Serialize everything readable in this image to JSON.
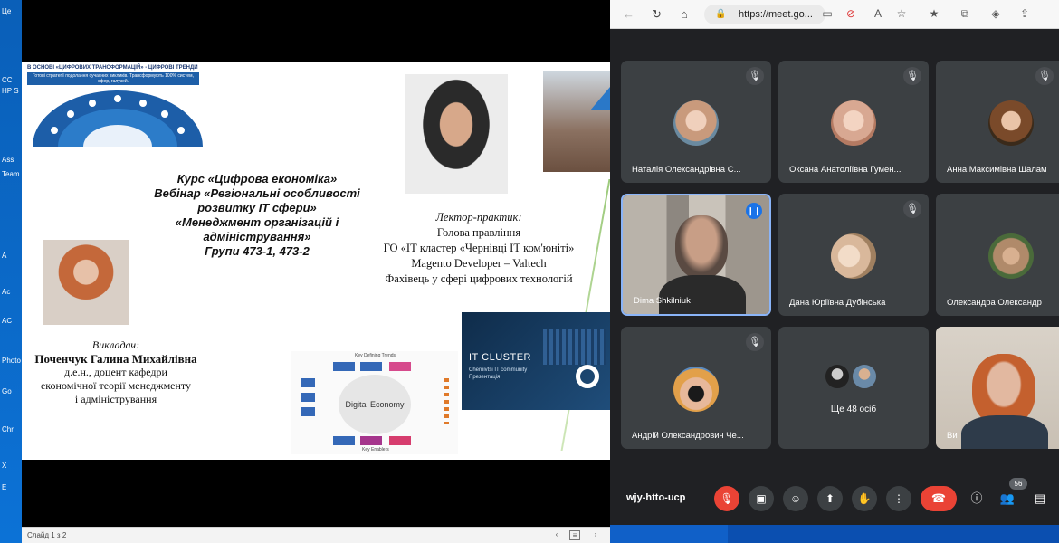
{
  "desktop": {
    "icons": [
      {
        "label": "Це",
        "color": "#2b7bd6"
      },
      {
        "label": "CC",
        "color": "#d9342b"
      },
      {
        "label": "HP S",
        "color": "#0a6fc2"
      },
      {
        "label": "Ass",
        "color": "#0a6fc2"
      },
      {
        "label": "Team",
        "color": "#5b5fc7"
      },
      {
        "label": "A",
        "color": "#d9342b"
      },
      {
        "label": "Ac",
        "color": "#d9342b"
      },
      {
        "label": "AC",
        "color": "#1f3a6b"
      },
      {
        "label": "Photo",
        "color": "#1f3a6b"
      },
      {
        "label": "Go",
        "color": "#e8e8e8"
      },
      {
        "label": "Chr",
        "color": "#e8e8e8"
      },
      {
        "label": "X",
        "color": "#1f7a3f"
      },
      {
        "label": "E",
        "color": "#1f7a3f"
      }
    ]
  },
  "presentation": {
    "status": {
      "slide_counter": "Слайд 1 з 2"
    },
    "slide": {
      "banner_head": "В ОСНОВІ «ЦИФРОВИХ ТРАНСФОРМАЦІЙ» - ЦИФРОВІ ТРЕНДИ",
      "banner_sub": "Готові стратегії подолання сучасних викликів. Трансформують 100% систем, сфер, галузей.",
      "title_lines": [
        "Курс «Цифрова економіка»",
        "Вебінар «Регіональні особливості",
        "розвитку ІТ сфери»",
        "«Менеджмент організацій і",
        "адміністрування»",
        "Групи 473-1, 473-2"
      ],
      "teacher_label": "Викладач:",
      "teacher_name": "Поченчук Галина Михайлівна",
      "teacher_lines": [
        "д.е.н., доцент кафедри",
        "економічної теорії менеджменту",
        "і адміністрування"
      ],
      "speaker_label": "Лектор-практик:",
      "speaker_lines": [
        "Голова правління",
        "ГО «ІТ кластер «Чернівці ІТ ком'юніті»",
        "Magento Developer – Valtech",
        "Фахівець у сфері цифрових технологій"
      ],
      "de_title": "Digital Economy",
      "de_top": "Key Defining Trends",
      "de_bottom": "Key Enablers",
      "itc_title": "IT CLUSTER",
      "itc_sub": "Chernivtsi IT community Презентація"
    }
  },
  "browser": {
    "url": "https://meet.go...",
    "icons": [
      "back-icon",
      "reload-icon",
      "home-icon",
      "lock-icon",
      "camera-icon",
      "blocked-icon",
      "read-aloud-icon",
      "favorite-icon",
      "favorites-icon",
      "collections-icon",
      "extensions-icon",
      "share-icon"
    ]
  },
  "meet": {
    "participants": [
      {
        "name": "Наталія Олександрівна С...",
        "muted": true,
        "avatar": "#c99a7c"
      },
      {
        "name": "Оксана Анатоліївна Гумен...",
        "muted": true,
        "avatar": "#d8a892"
      },
      {
        "name": "Анна Максимівна Шалам",
        "muted": true,
        "avatar": "#7a4a2a"
      },
      {
        "name": "Dima Shkilniuk",
        "muted": false,
        "speaking": true
      },
      {
        "name": "Дана Юріївна Дубінська",
        "muted": true,
        "avatar": "#d9b89b"
      },
      {
        "name": "Олександра Олександр",
        "muted": false,
        "avatar": "#b08a6a"
      },
      {
        "name": "Андрій Олександрович Че...",
        "muted": true,
        "avatar": "#e2a04a"
      },
      {
        "name": "Ви",
        "muted": false
      }
    ],
    "more_label": "Ще 48 осіб",
    "meeting_code": "wjy-htto-ucp",
    "people_count": "56"
  }
}
